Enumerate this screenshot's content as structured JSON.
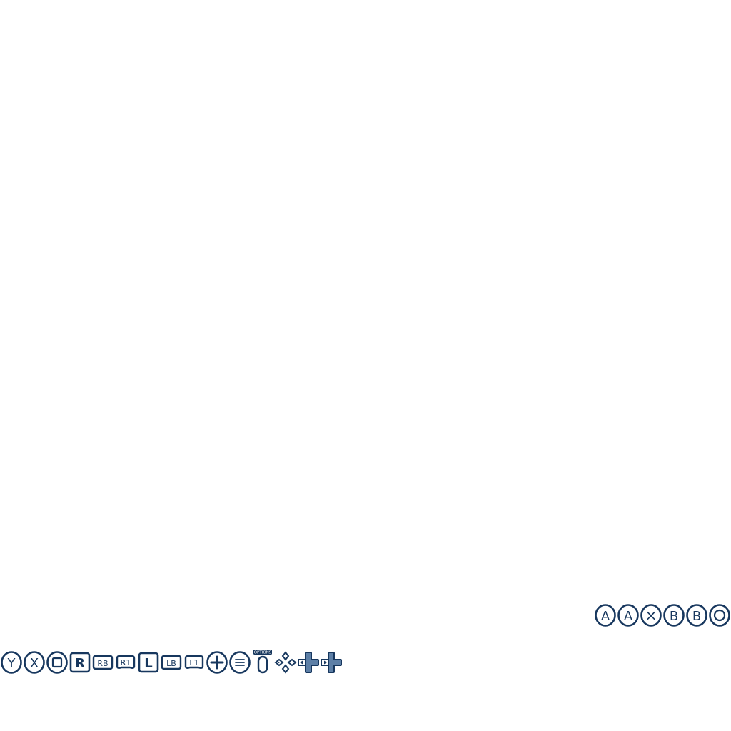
{
  "colors": {
    "stroke": "#17375e",
    "fill_light": "#ffffff",
    "fill_accent": "#5d7fa6"
  },
  "face_buttons": {
    "a1": "A",
    "a2": "A",
    "cross": "×",
    "b1": "B",
    "b2": "B",
    "circle": ""
  },
  "row_buttons": {
    "y": "Y",
    "x": "X",
    "square": "",
    "r": "R",
    "rb": "RB",
    "r1": "R1",
    "l": "L",
    "lb": "LB",
    "l1": "L1",
    "plus": "",
    "menu": "",
    "options_label": "OPTIONS"
  },
  "icons": [
    "button-a-icon",
    "button-a-alt-icon",
    "button-cross-icon",
    "button-b-icon",
    "button-b-alt-icon",
    "button-circle-icon",
    "button-y-icon",
    "button-x-icon",
    "button-square-icon",
    "button-r-icon",
    "button-rb-icon",
    "button-r1-icon",
    "button-l-icon",
    "button-lb-icon",
    "button-l1-icon",
    "button-plus-icon",
    "button-menu-icon",
    "button-options-icon",
    "dpad-outline-icon",
    "dpad-left-filled-icon",
    "dpad-right-filled-icon"
  ]
}
